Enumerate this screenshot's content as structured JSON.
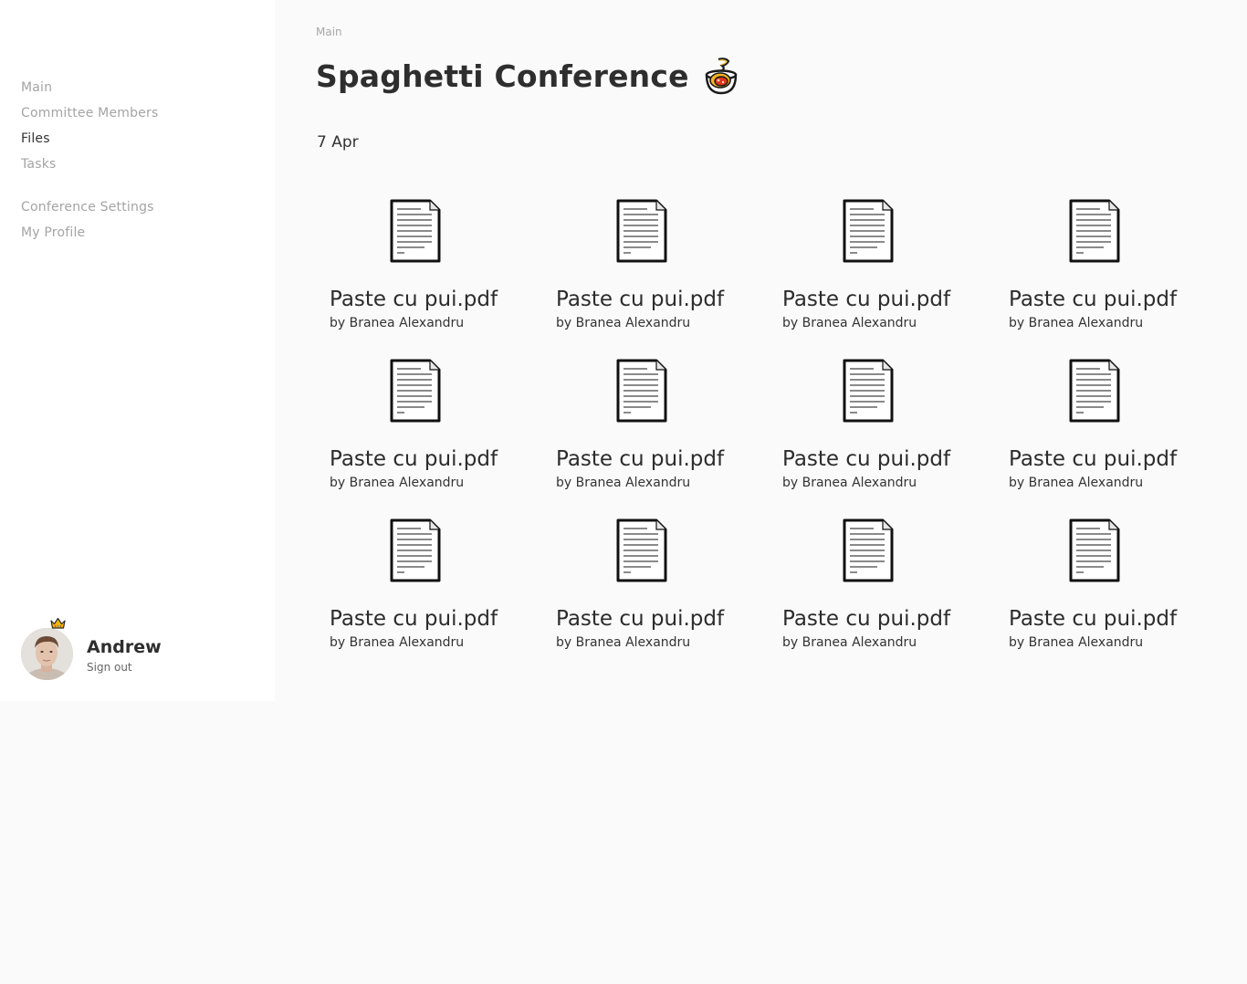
{
  "sidebar": {
    "nav": [
      {
        "label": "Main"
      },
      {
        "label": "Committee Members"
      },
      {
        "label": "Files",
        "active": true
      },
      {
        "label": "Tasks"
      }
    ],
    "nav_secondary": [
      {
        "label": "Conference Settings"
      },
      {
        "label": "My Profile"
      }
    ],
    "user": {
      "name": "Andrew",
      "sign_out_label": "Sign out",
      "badge_icon": "crown-icon"
    }
  },
  "main": {
    "breadcrumb": "Main",
    "title": "Spaghetti Conference",
    "title_icon": "spaghetti-bowl-icon",
    "date_group": "7 Apr",
    "files": [
      {
        "name": "Paste cu pui.pdf",
        "author": "by Branea Alexandru"
      },
      {
        "name": "Paste cu pui.pdf",
        "author": "by Branea Alexandru"
      },
      {
        "name": "Paste cu pui.pdf",
        "author": "by Branea Alexandru"
      },
      {
        "name": "Paste cu pui.pdf",
        "author": "by Branea Alexandru"
      },
      {
        "name": "Paste cu pui.pdf",
        "author": "by Branea Alexandru"
      },
      {
        "name": "Paste cu pui.pdf",
        "author": "by Branea Alexandru"
      },
      {
        "name": "Paste cu pui.pdf",
        "author": "by Branea Alexandru"
      },
      {
        "name": "Paste cu pui.pdf",
        "author": "by Branea Alexandru"
      },
      {
        "name": "Paste cu pui.pdf",
        "author": "by Branea Alexandru"
      },
      {
        "name": "Paste cu pui.pdf",
        "author": "by Branea Alexandru"
      },
      {
        "name": "Paste cu pui.pdf",
        "author": "by Branea Alexandru"
      },
      {
        "name": "Paste cu pui.pdf",
        "author": "by Branea Alexandru"
      }
    ]
  },
  "colors": {
    "background": "#fafafa",
    "sidebar": "#ffffff",
    "nav_inactive": "#a4a4a4",
    "text": "#2c2c2c"
  }
}
